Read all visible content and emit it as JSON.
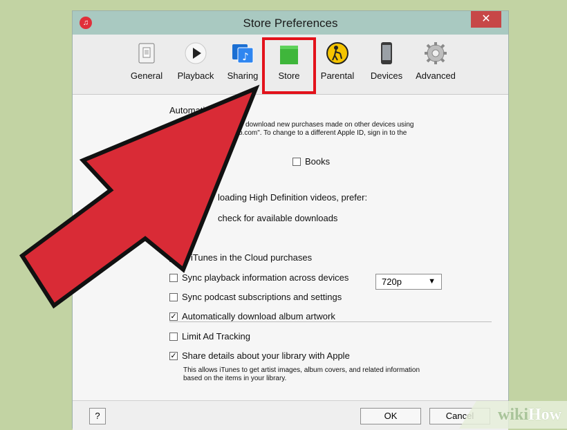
{
  "window": {
    "title": "Store Preferences",
    "close_glyph": "✕",
    "app_icon_glyph": "♫"
  },
  "toolbar": {
    "tabs": [
      {
        "label": "General",
        "icon": "switch-icon"
      },
      {
        "label": "Playback",
        "icon": "play-icon"
      },
      {
        "label": "Sharing",
        "icon": "music-note-icon"
      },
      {
        "label": "Store",
        "icon": "shopping-bag-icon",
        "selected": true
      },
      {
        "label": "Parental",
        "icon": "parental-icon"
      },
      {
        "label": "Devices",
        "icon": "phone-icon"
      },
      {
        "label": "Advanced",
        "icon": "gear-icon"
      }
    ],
    "highlight_color": "#e3121b"
  },
  "store": {
    "auto_heading": "Automatic",
    "auto_desc_line1": "ly download new purchases made on other devices using",
    "auto_desc_line2": "o.com\". To change to a different Apple ID, sign in to the",
    "books_label": "Books",
    "hd_label": "loading High Definition videos, prefer:",
    "hd_value": "720p",
    "check_downloads_label": "check for available downloads",
    "options": [
      {
        "label": "w iTunes in the Cloud purchases",
        "checked": false
      },
      {
        "label": "Sync playback information across devices",
        "checked": false
      },
      {
        "label": "Sync podcast subscriptions and settings",
        "checked": false
      },
      {
        "label": "Automatically download album artwork",
        "checked": true
      },
      {
        "label": "Limit Ad Tracking",
        "checked": false
      },
      {
        "label": "Share details about your library with Apple",
        "checked": true
      }
    ],
    "share_desc": "This allows iTunes to get artist images, album covers, and related information based on the items in your library."
  },
  "footer": {
    "help_label": "?",
    "ok_label": "OK",
    "cancel_label": "Cancel"
  },
  "watermark": {
    "wiki": "wiki",
    "how": "How"
  },
  "colors": {
    "background": "#c2d3a3",
    "titlebar": "#a9c9c1",
    "close_button": "#c74747",
    "arrow": "#d92b36"
  }
}
